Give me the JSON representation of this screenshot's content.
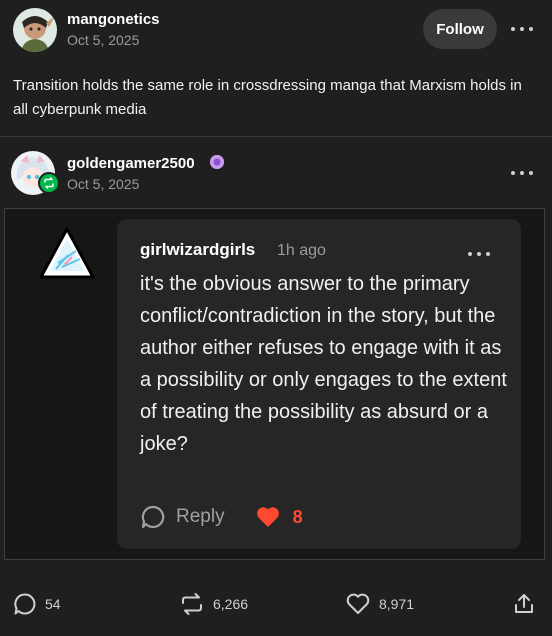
{
  "post": {
    "author": "mangonetics",
    "date": "Oct 5, 2025",
    "follow_label": "Follow",
    "text": "Transition holds the same role in crossdressing manga that Marxism holds in all cyberpunk media"
  },
  "reblog": {
    "author": "goldengamer2500",
    "date": "Oct 5, 2025"
  },
  "reply": {
    "author": "girlwizardgirls",
    "time": "1h ago",
    "body": "it's the obvious answer to the primary conflict/contradiction in the story, but the author either refuses to engage with it as a possibility or only engages to the extent of treating the possibility as absurd or a joke?",
    "reply_label": "Reply",
    "like_count": "8"
  },
  "footer": {
    "comments": "54",
    "reblogs": "6,266",
    "likes": "8,971"
  },
  "icons": {
    "more": "more-dots-icon",
    "reblog_badge": "reblog-icon",
    "comment": "speech-bubble-icon",
    "reblog": "reblog-icon",
    "like": "heart-icon",
    "share": "share-icon"
  },
  "colors": {
    "background": "#1f1f1f",
    "card": "#262626",
    "accent_green": "#00b84a",
    "like_red": "#ff4930"
  }
}
